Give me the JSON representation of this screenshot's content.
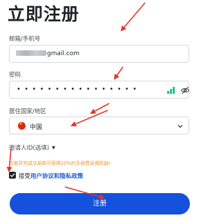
{
  "page_title": "立即注册",
  "email": {
    "label": "邮箱/手机号",
    "value_visible_suffix": "gmail.com"
  },
  "password": {
    "label": "密码",
    "masked_value": "••••••••••••••••"
  },
  "country": {
    "label": "居住国家/地区",
    "selected": "中国",
    "flag_icon": "china-flag-icon"
  },
  "referral": {
    "label": "邀请人ID(选填)"
  },
  "promo_text": "注册并完成交易即可获得20%的手续费返佣奖励!",
  "agreement": {
    "prefix": "接受",
    "link": "用户协议和隐私政策",
    "checked": true
  },
  "register_button": "注册",
  "colors": {
    "primary": "#1451dd",
    "annotation_arrow": "#e53525",
    "promo": "#f0932b",
    "strength": "#0ecb81"
  }
}
